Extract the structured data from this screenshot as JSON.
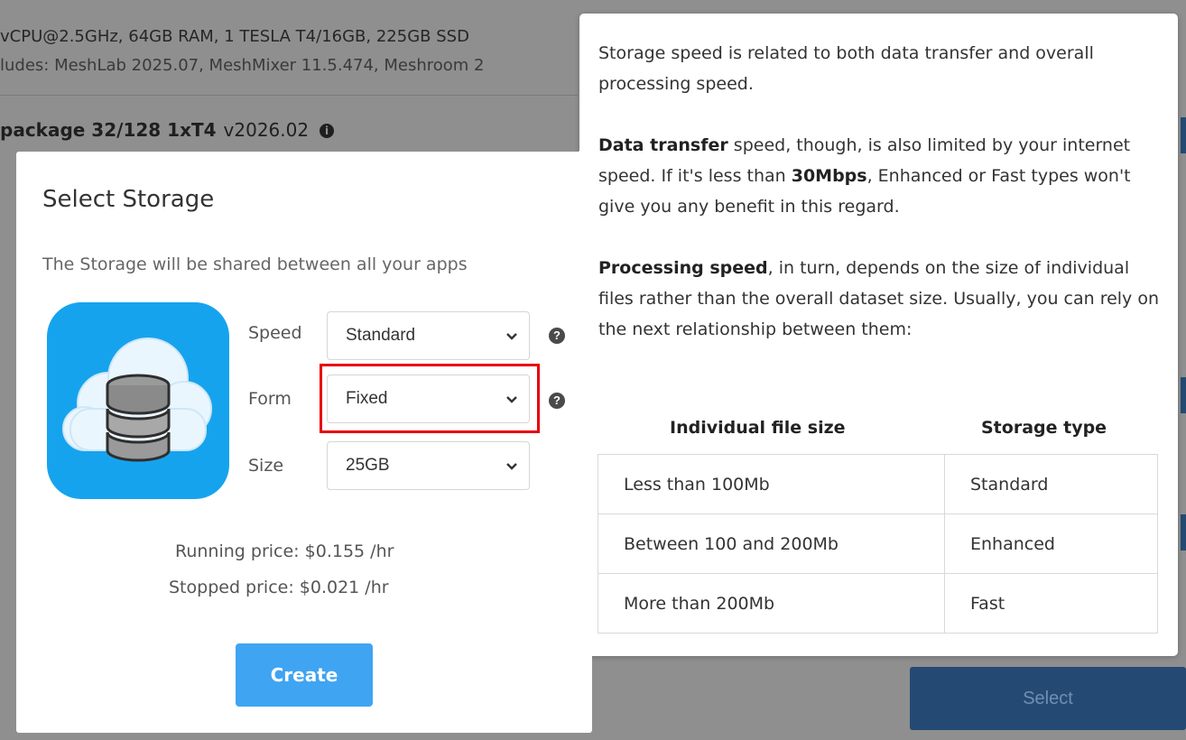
{
  "background": {
    "spec_line": "vCPU@2.5GHz, 64GB RAM, 1 TESLA T4/16GB, 225GB SSD",
    "includes_line": "ludes: MeshLab 2025.07, MeshMixer 11.5.474, Meshroom 2",
    "package_title": "package 32/128 1xT4",
    "package_version": "v2026.02",
    "select_button": "Select"
  },
  "modal": {
    "title": "Select Storage",
    "subtitle": "The Storage will be shared between all your apps",
    "icon": "cloud-database-icon",
    "fields": {
      "speed": {
        "label": "Speed",
        "value": "Standard"
      },
      "form": {
        "label": "Form",
        "value": "Fixed"
      },
      "size": {
        "label": "Size",
        "value": "25GB"
      }
    },
    "running_price_label": "Running price:",
    "running_price_value": "$0.155 /hr",
    "stopped_price_label": "Stopped price:",
    "stopped_price_value": "$0.021 /hr",
    "create_button": "Create"
  },
  "popover": {
    "p1": "Storage speed is related to both data transfer and overall processing speed.",
    "p2_bold": "Data transfer",
    "p2_a": " speed, though, is also limited by your internet speed. If it's less than ",
    "p2_bold2": "30Mbps",
    "p2_b": ", Enhanced or Fast types won't give you any benefit in this regard.",
    "p3_bold": "Processing speed",
    "p3_rest": ", in turn, depends on the size of individual files rather than the overall dataset size. Usually, you can rely on the next relationship between them:",
    "table_headers": [
      "Individual file size",
      "Storage type"
    ],
    "table_rows": [
      [
        "Less than 100Mb",
        "Standard"
      ],
      [
        "Between 100 and 200Mb",
        "Enhanced"
      ],
      [
        "More than 200Mb",
        "Fast"
      ]
    ]
  },
  "colors": {
    "highlight": "#e8000b",
    "create_button": "#3fa4f2",
    "icon_bg": "#16a3ee"
  }
}
